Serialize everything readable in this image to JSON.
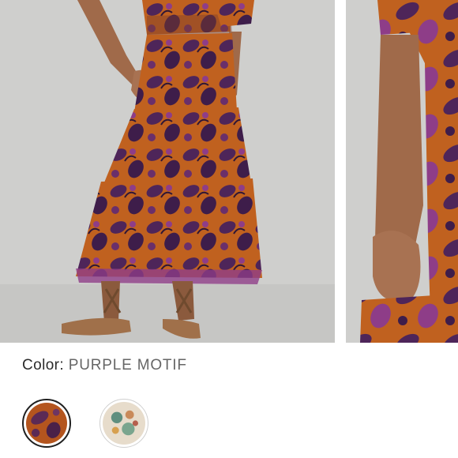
{
  "product": {
    "color_label": "Color:",
    "color_value": "PURPLE MOTIF"
  },
  "gallery": {
    "images": [
      {
        "name": "model-full-skirt-photo"
      },
      {
        "name": "model-detail-crop-photo"
      }
    ]
  },
  "swatches": [
    {
      "name": "purple-motif",
      "selected": true,
      "colors": {
        "base": "#b4551e",
        "motif": "#5b2a55"
      }
    },
    {
      "name": "floral-cream",
      "selected": false,
      "colors": {
        "base": "#e7dccb",
        "motif": "#5f8f7f"
      }
    }
  ],
  "colors": {
    "skirt_orange": "#c0611f",
    "print_purple": "#4e2559",
    "print_magenta": "#8e3d88",
    "backdrop": "#cfcfcd",
    "skin": "#a06a4a"
  }
}
